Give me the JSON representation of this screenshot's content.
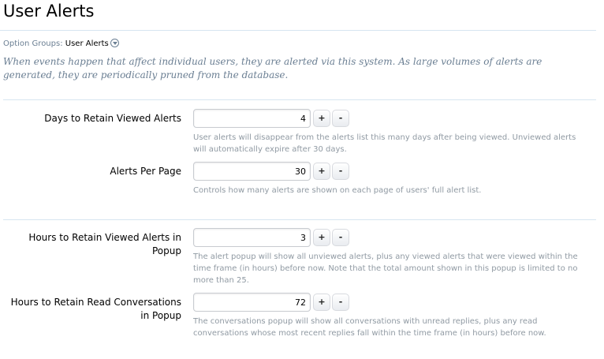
{
  "page": {
    "title": "User Alerts",
    "option_groups_label": "Option Groups:",
    "option_group_value": "User Alerts",
    "description": "When events happen that affect individual users, they are alerted via this system. As large volumes of alerts are generated, they are periodically pruned from the database."
  },
  "options": [
    {
      "label": "Days to Retain Viewed Alerts",
      "value": "4",
      "plus": "+",
      "minus": "-",
      "hint": "User alerts will disappear from the alerts list this many days after being viewed. Unviewed alerts will automatically expire after 30 days."
    },
    {
      "label": "Alerts Per Page",
      "value": "30",
      "plus": "+",
      "minus": "-",
      "hint": "Controls how many alerts are shown on each page of users' full alert list."
    },
    {
      "label": "Hours to Retain Viewed Alerts in Popup",
      "value": "3",
      "plus": "+",
      "minus": "-",
      "hint": "The alert popup will show all unviewed alerts, plus any viewed alerts that were viewed within the time frame (in hours) before now. Note that the total amount shown in this popup is limited to no more than 25."
    },
    {
      "label": "Hours to Retain Read Conversations in Popup",
      "value": "72",
      "plus": "+",
      "minus": "-",
      "hint": "The conversations popup will show all conversations with unread replies, plus any read conversations whose most recent replies fall within the time frame (in hours) before now."
    }
  ]
}
